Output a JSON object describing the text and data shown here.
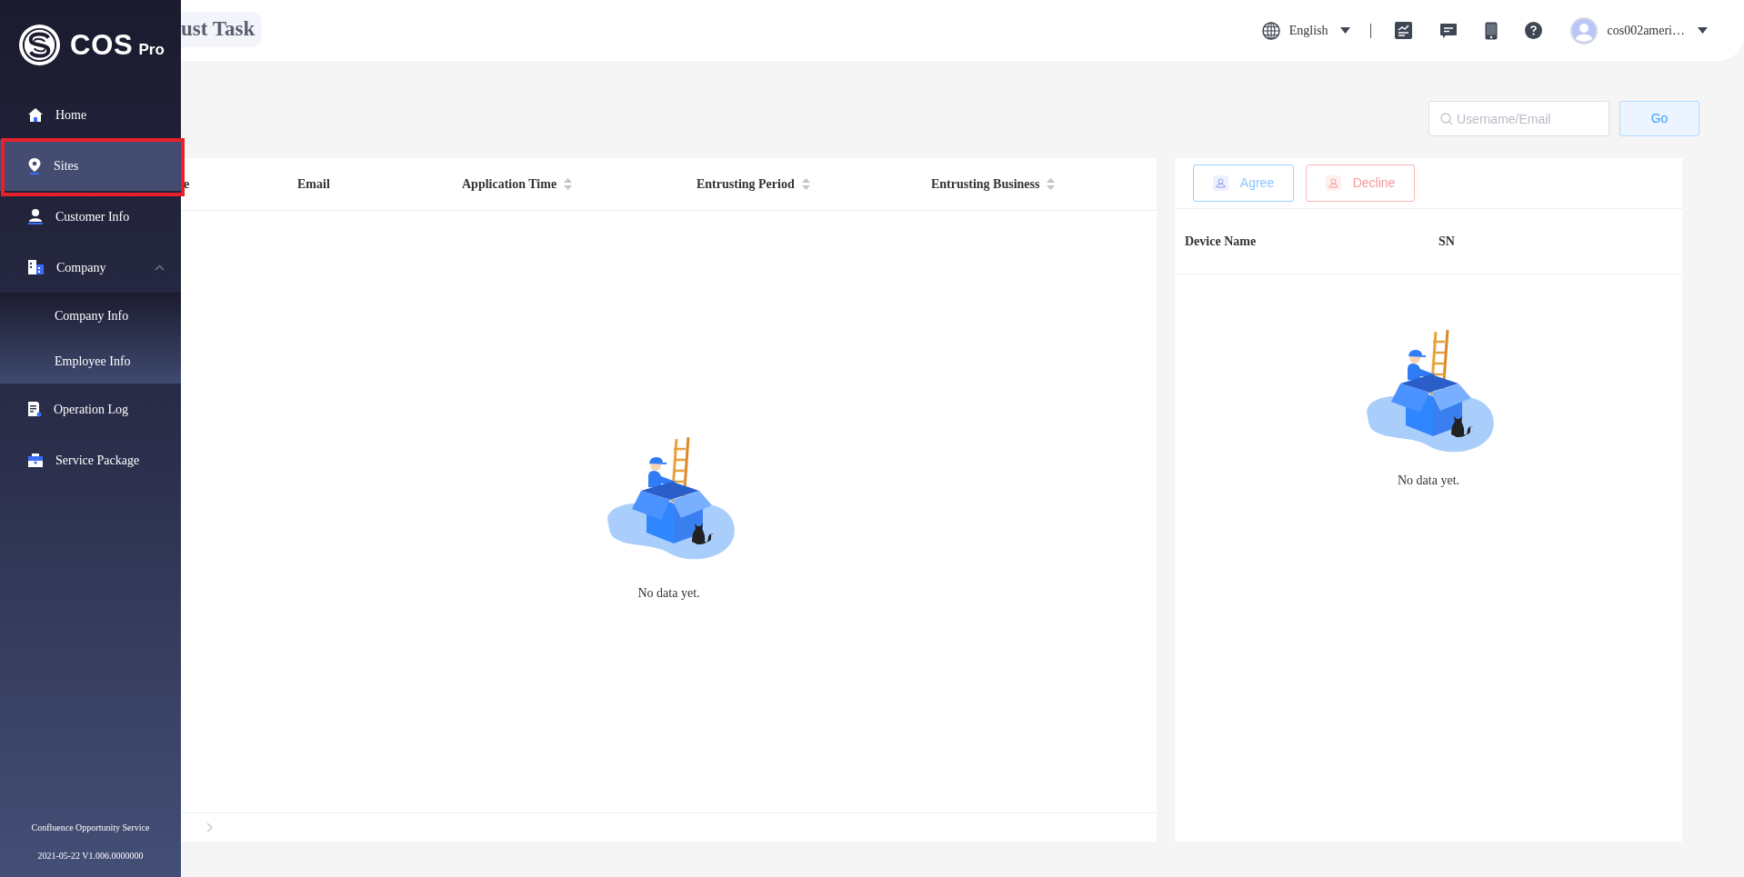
{
  "sidebar": {
    "logo": {
      "wordmark": "COS",
      "suffix": "Pro"
    },
    "items": [
      {
        "label": "Home",
        "kind": "home",
        "selected": false,
        "highlighted": false
      },
      {
        "label": "Sites",
        "kind": "pin",
        "selected": true,
        "highlighted": true
      },
      {
        "label": "Customer Info",
        "kind": "person",
        "selected": false,
        "highlighted": false
      },
      {
        "label": "Company",
        "kind": "building",
        "selected": false,
        "highlighted": false,
        "expanded": true,
        "children": [
          {
            "label": "Company Info",
            "selected": false
          },
          {
            "label": "Employee Info",
            "selected": false
          }
        ]
      },
      {
        "label": "Operation Log",
        "kind": "log",
        "selected": false,
        "highlighted": false
      },
      {
        "label": "Service Package",
        "kind": "package",
        "selected": false,
        "highlighted": false
      }
    ],
    "footer": {
      "name": "Confluence Opportunity Service",
      "version": "2021-05-22 V1.006.0000000"
    }
  },
  "header": {
    "title": "ust Task",
    "language": "English",
    "user": "cos002ameri…"
  },
  "search": {
    "placeholder": "Username/Email",
    "button": "Go"
  },
  "task_table": {
    "columns": [
      {
        "label": "e",
        "sortable": false
      },
      {
        "label": "Email",
        "sortable": false
      },
      {
        "label": "Application Time",
        "sortable": true
      },
      {
        "label": "Entrusting Period",
        "sortable": true
      },
      {
        "label": "Entrusting Business",
        "sortable": true
      }
    ],
    "empty_text": "No data yet."
  },
  "device_panel": {
    "actions": [
      {
        "label": "Agree",
        "kind": "agree"
      },
      {
        "label": "Decline",
        "kind": "decline"
      }
    ],
    "columns": [
      "Device Name",
      "SN"
    ],
    "empty_text": "No data yet."
  }
}
